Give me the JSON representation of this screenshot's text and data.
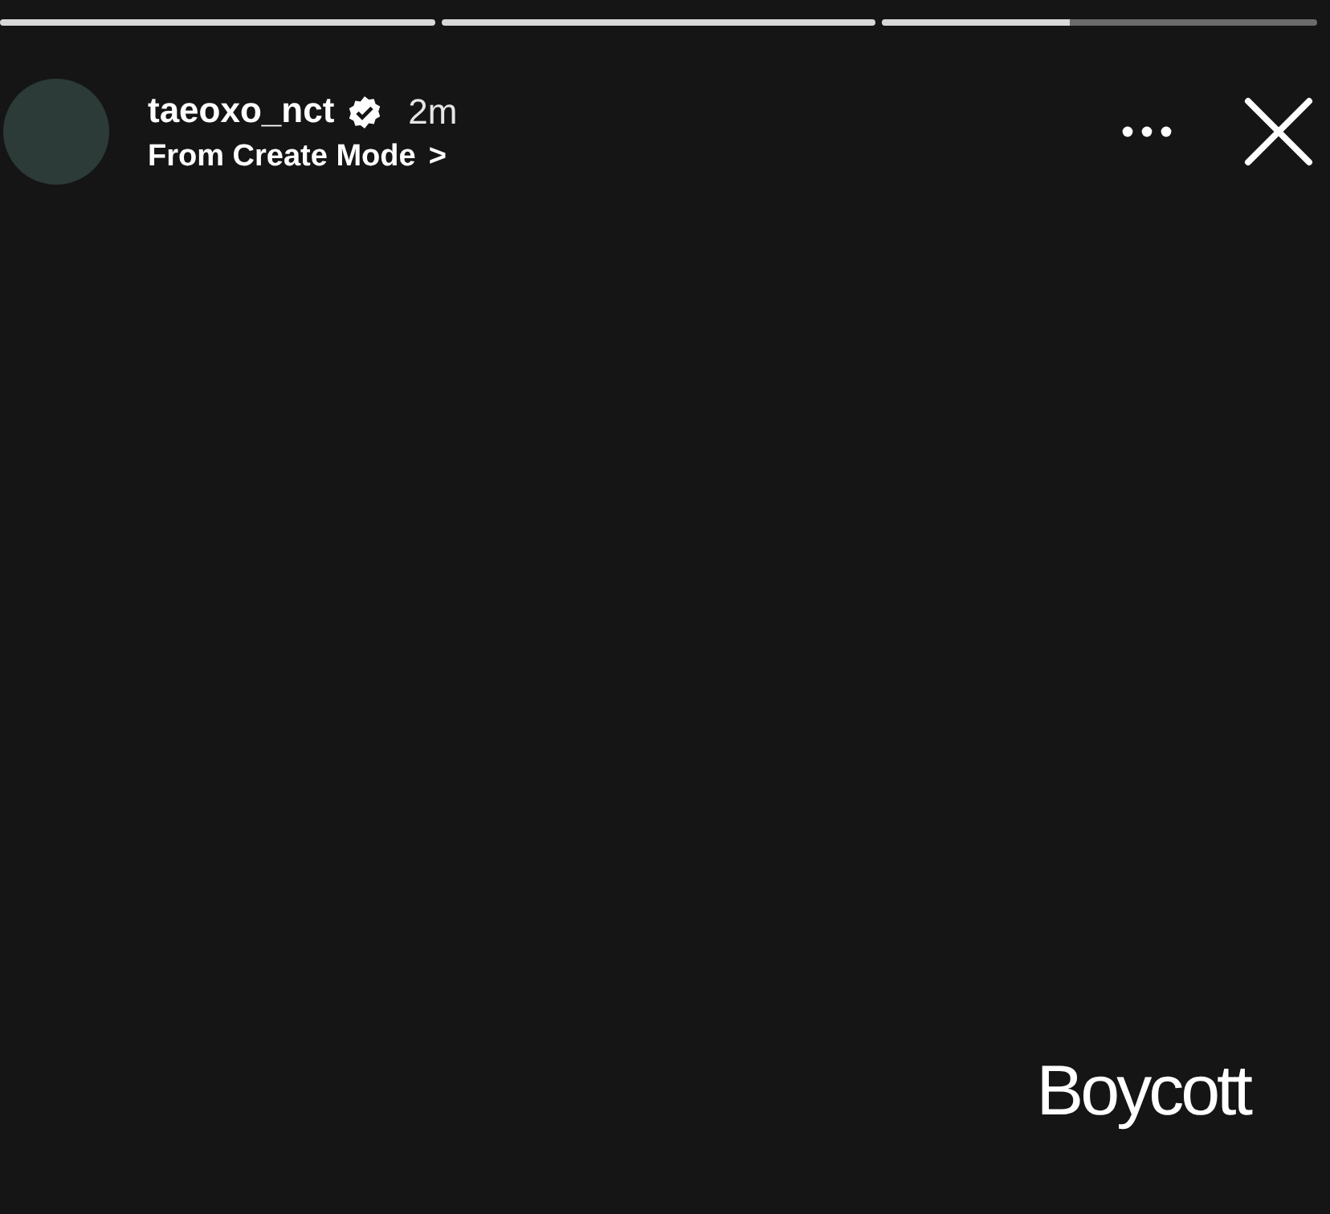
{
  "progress_bars": [
    {
      "level": 1
    },
    {
      "level": 1
    },
    {
      "level": 0.43
    }
  ],
  "header": {
    "username": "taeoxo_nct",
    "verified": true,
    "time": "2m",
    "subtitle": "From Create Mode",
    "subtitle_arrow": ">"
  },
  "story": {
    "text": "Boycott"
  }
}
